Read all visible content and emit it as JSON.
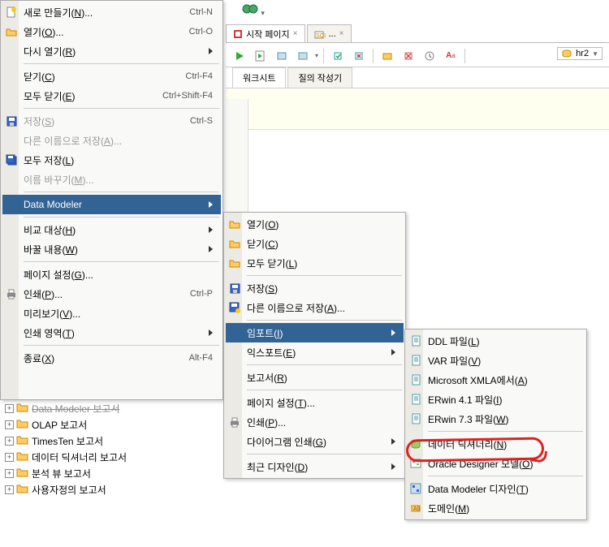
{
  "bg": {
    "tab1": "시작 페이지",
    "tab2": "...",
    "subtab1": "워크시트",
    "subtab2": "질의 작성기",
    "conn_label": "hr2"
  },
  "menu1": [
    {
      "icon": "new",
      "label": "새로 만들기(N)...",
      "shortcut": "Ctrl-N"
    },
    {
      "icon": "open",
      "label": "열기(O)...",
      "shortcut": "Ctrl-O"
    },
    {
      "label": "다시 열기(R)",
      "arrow": true
    },
    {
      "sep": true
    },
    {
      "label": "닫기(C)",
      "shortcut": "Ctrl-F4"
    },
    {
      "label": "모두 닫기(E)",
      "shortcut": "Ctrl+Shift-F4"
    },
    {
      "sep": true
    },
    {
      "icon": "save",
      "label": "저장(S)",
      "shortcut": "Ctrl-S",
      "disabled": true
    },
    {
      "label": "다른 이름으로 저장(A)...",
      "disabled": true
    },
    {
      "icon": "saveall",
      "label": "모두 저장(L)"
    },
    {
      "label": "이름 바꾸기(M)...",
      "disabled": true
    },
    {
      "sep": true
    },
    {
      "label": "Data Modeler",
      "arrow": true,
      "hl": true
    },
    {
      "sep": true
    },
    {
      "label": "비교 대상(H)",
      "arrow": true
    },
    {
      "label": "바꿀 내용(W)",
      "arrow": true
    },
    {
      "sep": true
    },
    {
      "label": "페이지 설정(G)..."
    },
    {
      "icon": "print",
      "label": "인쇄(P)...",
      "shortcut": "Ctrl-P"
    },
    {
      "label": "미리보기(V)..."
    },
    {
      "label": "인쇄 영역(T)",
      "arrow": true
    },
    {
      "sep": true
    },
    {
      "label": "종료(X)",
      "shortcut": "Alt-F4"
    }
  ],
  "menu2": [
    {
      "icon": "folder",
      "label": "열기(O)"
    },
    {
      "icon": "folder",
      "label": "닫기(C)"
    },
    {
      "icon": "folder",
      "label": "모두 닫기(L)"
    },
    {
      "sep": true
    },
    {
      "icon": "save",
      "label": "저장(S)"
    },
    {
      "icon": "saveas",
      "label": "다른 이름으로 저장(A)..."
    },
    {
      "sep": true
    },
    {
      "label": "임포트(I)",
      "arrow": true,
      "hl": true
    },
    {
      "label": "익스포트(E)",
      "arrow": true
    },
    {
      "sep": true
    },
    {
      "label": "보고서(R)"
    },
    {
      "sep": true
    },
    {
      "label": "페이지 설정(T)..."
    },
    {
      "icon": "print",
      "label": "인쇄(P)..."
    },
    {
      "label": "다이어그램 인쇄(G)",
      "arrow": true
    },
    {
      "sep": true
    },
    {
      "label": "최근 디자인(D)",
      "arrow": true
    }
  ],
  "menu3": [
    {
      "icon": "doc",
      "label": "DDL 파일(L)"
    },
    {
      "icon": "doc",
      "label": "VAR 파일(V)"
    },
    {
      "icon": "doc",
      "label": "Microsoft XMLA에서(A)"
    },
    {
      "icon": "doc",
      "label": "ERwin 4.1 파일(I)"
    },
    {
      "icon": "doc",
      "label": "ERwin 7.3 파일(W)"
    },
    {
      "sep": true
    },
    {
      "icon": "dd",
      "label": "데이터 딕셔너리(N)"
    },
    {
      "icon": "od",
      "label": "Oracle Designer 모델(O)"
    },
    {
      "sep": true
    },
    {
      "icon": "dm",
      "label": "Data Modeler 디자인(T)"
    },
    {
      "icon": "dom",
      "label": "도메인(M)"
    }
  ],
  "tree": [
    "Data Modeler 보고서",
    "OLAP 보고서",
    "TimesTen 보고서",
    "데이터 딕셔너리 보고서",
    "분석 뷰 보고서",
    "사용자정의 보고서"
  ]
}
